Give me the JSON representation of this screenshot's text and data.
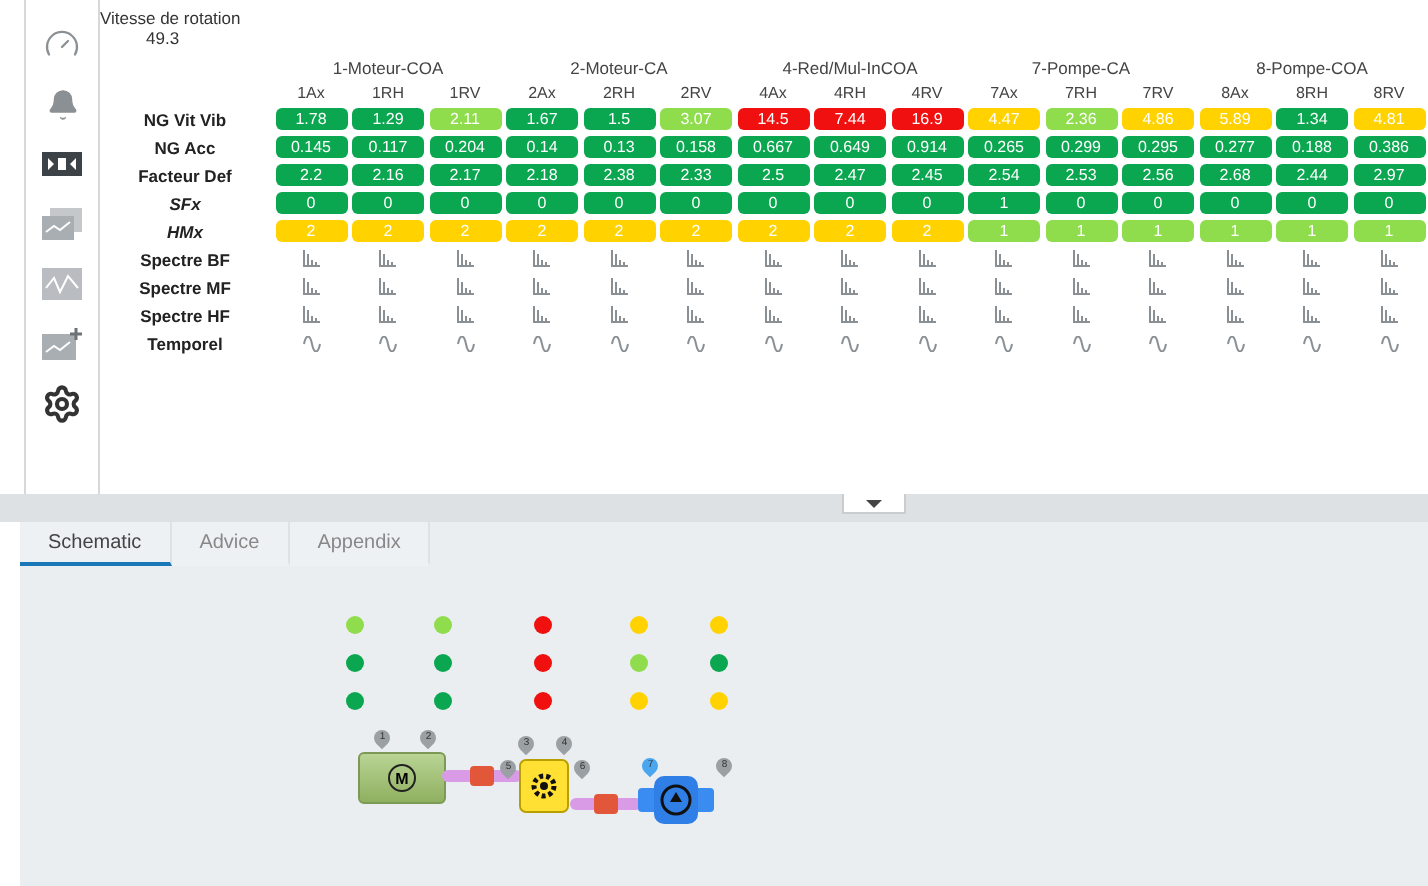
{
  "sidebar": {
    "items": [
      {
        "kind": "gauge"
      },
      {
        "kind": "bell"
      },
      {
        "kind": "strip"
      },
      {
        "kind": "windows"
      },
      {
        "kind": "chart"
      },
      {
        "kind": "chart-add"
      },
      {
        "kind": "settings"
      }
    ]
  },
  "speed": {
    "label": "Vitesse de rotation",
    "value": "49.3"
  },
  "table": {
    "groups": [
      "1-Moteur-COA",
      "2-Moteur-CA",
      "4-Red/Mul-InCOA",
      "7-Pompe-CA",
      "8-Pompe-COA"
    ],
    "columns": [
      "1Ax",
      "1RH",
      "1RV",
      "2Ax",
      "2RH",
      "2RV",
      "4Ax",
      "4RH",
      "4RV",
      "7Ax",
      "7RH",
      "7RV",
      "8Ax",
      "8RH",
      "8RV"
    ],
    "rows": [
      {
        "label": "NG Vit Vib",
        "kind": "values",
        "italic": false,
        "cells": [
          {
            "value": "1.78",
            "color": "#0ba650"
          },
          {
            "value": "1.29",
            "color": "#0ba650"
          },
          {
            "value": "2.11",
            "color": "#8fdd4d"
          },
          {
            "value": "1.67",
            "color": "#0ba650"
          },
          {
            "value": "1.5",
            "color": "#0ba650"
          },
          {
            "value": "3.07",
            "color": "#8fdd4d"
          },
          {
            "value": "14.5",
            "color": "#f01010"
          },
          {
            "value": "7.44",
            "color": "#f01010"
          },
          {
            "value": "16.9",
            "color": "#f01010"
          },
          {
            "value": "4.47",
            "color": "#ffd200"
          },
          {
            "value": "2.36",
            "color": "#8fdd4d"
          },
          {
            "value": "4.86",
            "color": "#ffd200"
          },
          {
            "value": "5.89",
            "color": "#ffd200"
          },
          {
            "value": "1.34",
            "color": "#0ba650"
          },
          {
            "value": "4.81",
            "color": "#ffd200"
          }
        ]
      },
      {
        "label": "NG Acc",
        "kind": "values",
        "italic": false,
        "cells": [
          {
            "value": "0.145",
            "color": "#0ba650"
          },
          {
            "value": "0.117",
            "color": "#0ba650"
          },
          {
            "value": "0.204",
            "color": "#0ba650"
          },
          {
            "value": "0.14",
            "color": "#0ba650"
          },
          {
            "value": "0.13",
            "color": "#0ba650"
          },
          {
            "value": "0.158",
            "color": "#0ba650"
          },
          {
            "value": "0.667",
            "color": "#0ba650"
          },
          {
            "value": "0.649",
            "color": "#0ba650"
          },
          {
            "value": "0.914",
            "color": "#0ba650"
          },
          {
            "value": "0.265",
            "color": "#0ba650"
          },
          {
            "value": "0.299",
            "color": "#0ba650"
          },
          {
            "value": "0.295",
            "color": "#0ba650"
          },
          {
            "value": "0.277",
            "color": "#0ba650"
          },
          {
            "value": "0.188",
            "color": "#0ba650"
          },
          {
            "value": "0.386",
            "color": "#0ba650"
          }
        ]
      },
      {
        "label": "Facteur Def",
        "kind": "values",
        "italic": false,
        "cells": [
          {
            "value": "2.2",
            "color": "#0ba650"
          },
          {
            "value": "2.16",
            "color": "#0ba650"
          },
          {
            "value": "2.17",
            "color": "#0ba650"
          },
          {
            "value": "2.18",
            "color": "#0ba650"
          },
          {
            "value": "2.38",
            "color": "#0ba650"
          },
          {
            "value": "2.33",
            "color": "#0ba650"
          },
          {
            "value": "2.5",
            "color": "#0ba650"
          },
          {
            "value": "2.47",
            "color": "#0ba650"
          },
          {
            "value": "2.45",
            "color": "#0ba650"
          },
          {
            "value": "2.54",
            "color": "#0ba650"
          },
          {
            "value": "2.53",
            "color": "#0ba650"
          },
          {
            "value": "2.56",
            "color": "#0ba650"
          },
          {
            "value": "2.68",
            "color": "#0ba650"
          },
          {
            "value": "2.44",
            "color": "#0ba650"
          },
          {
            "value": "2.97",
            "color": "#0ba650"
          }
        ]
      },
      {
        "label": "SFx",
        "kind": "values",
        "italic": true,
        "cells": [
          {
            "value": "0",
            "color": "#0ba650"
          },
          {
            "value": "0",
            "color": "#0ba650"
          },
          {
            "value": "0",
            "color": "#0ba650"
          },
          {
            "value": "0",
            "color": "#0ba650"
          },
          {
            "value": "0",
            "color": "#0ba650"
          },
          {
            "value": "0",
            "color": "#0ba650"
          },
          {
            "value": "0",
            "color": "#0ba650"
          },
          {
            "value": "0",
            "color": "#0ba650"
          },
          {
            "value": "0",
            "color": "#0ba650"
          },
          {
            "value": "1",
            "color": "#0ba650"
          },
          {
            "value": "0",
            "color": "#0ba650"
          },
          {
            "value": "0",
            "color": "#0ba650"
          },
          {
            "value": "0",
            "color": "#0ba650"
          },
          {
            "value": "0",
            "color": "#0ba650"
          },
          {
            "value": "0",
            "color": "#0ba650"
          }
        ]
      },
      {
        "label": "HMx",
        "kind": "values",
        "italic": true,
        "cells": [
          {
            "value": "2",
            "color": "#ffd200"
          },
          {
            "value": "2",
            "color": "#ffd200"
          },
          {
            "value": "2",
            "color": "#ffd200"
          },
          {
            "value": "2",
            "color": "#ffd200"
          },
          {
            "value": "2",
            "color": "#ffd200"
          },
          {
            "value": "2",
            "color": "#ffd200"
          },
          {
            "value": "2",
            "color": "#ffd200"
          },
          {
            "value": "2",
            "color": "#ffd200"
          },
          {
            "value": "2",
            "color": "#ffd200"
          },
          {
            "value": "1",
            "color": "#8fdd4d"
          },
          {
            "value": "1",
            "color": "#8fdd4d"
          },
          {
            "value": "1",
            "color": "#8fdd4d"
          },
          {
            "value": "1",
            "color": "#8fdd4d"
          },
          {
            "value": "1",
            "color": "#8fdd4d"
          },
          {
            "value": "1",
            "color": "#8fdd4d"
          }
        ]
      },
      {
        "label": "Spectre BF",
        "kind": "spectrum",
        "italic": false
      },
      {
        "label": "Spectre MF",
        "kind": "spectrum",
        "italic": false
      },
      {
        "label": "Spectre HF",
        "kind": "spectrum",
        "italic": false
      },
      {
        "label": "Temporel",
        "kind": "wave",
        "italic": false
      }
    ]
  },
  "tabs": [
    {
      "label": "Schematic",
      "selected": true
    },
    {
      "label": "Advice",
      "selected": false
    },
    {
      "label": "Appendix",
      "selected": false
    }
  ],
  "schematic": {
    "dot_columns": [
      {
        "dots": [
          {
            "color": "#8fdd4d"
          },
          {
            "color": "#0ba650"
          },
          {
            "color": "#0ba650"
          }
        ]
      },
      {
        "dots": [
          {
            "color": "#8fdd4d"
          },
          {
            "color": "#0ba650"
          },
          {
            "color": "#0ba650"
          }
        ]
      },
      {
        "dots": [
          {
            "color": "#f01010"
          },
          {
            "color": "#f01010"
          },
          {
            "color": "#f01010"
          }
        ]
      },
      {
        "dots": [
          {
            "color": "#ffd200"
          },
          {
            "color": "#8fdd4d"
          },
          {
            "color": "#ffd200"
          }
        ]
      },
      {
        "dots": [
          {
            "color": "#ffd200"
          },
          {
            "color": "#0ba650"
          },
          {
            "color": "#ffd200"
          }
        ]
      }
    ],
    "motor": {
      "symbol": "M"
    },
    "pins": [
      {
        "label": "1",
        "kind": "grey"
      },
      {
        "label": "2",
        "kind": "grey"
      },
      {
        "label": "3",
        "kind": "grey"
      },
      {
        "label": "4",
        "kind": "grey"
      },
      {
        "label": "5",
        "kind": "grey"
      },
      {
        "label": "6",
        "kind": "grey"
      },
      {
        "label": "7",
        "kind": "blue"
      },
      {
        "label": "8",
        "kind": "grey"
      }
    ]
  }
}
